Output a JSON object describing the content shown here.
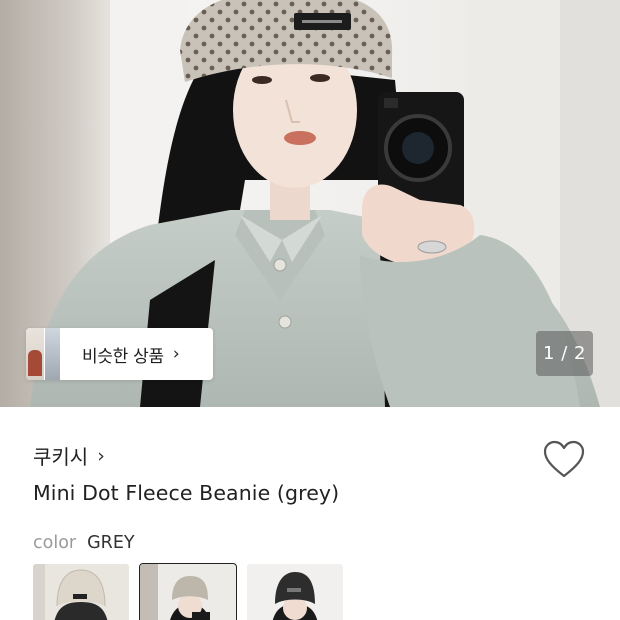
{
  "hero": {
    "image_alt": "Model wearing grey dot fleece beanie taking mirror selfie",
    "similar_products_label": "비슷한 상품",
    "similar_products_chevron": "›",
    "page_counter": "1 / 2"
  },
  "product": {
    "brand": "쿠키시",
    "brand_chevron": "›",
    "title": "Mini Dot Fleece Beanie (grey)",
    "color_label": "color",
    "color_value": "GREY"
  },
  "swatches": [
    {
      "name": "ivory",
      "selected": false
    },
    {
      "name": "grey",
      "selected": true
    },
    {
      "name": "black",
      "selected": false
    }
  ],
  "icons": {
    "wishlist": "heart-outline-icon",
    "chevron": "chevron-right-icon"
  },
  "colors": {
    "background": "#ffffff",
    "text_primary": "#222222",
    "text_muted": "#9a9a9a",
    "counter_bg": "#5a5a5a",
    "selected_outline": "#222222"
  }
}
